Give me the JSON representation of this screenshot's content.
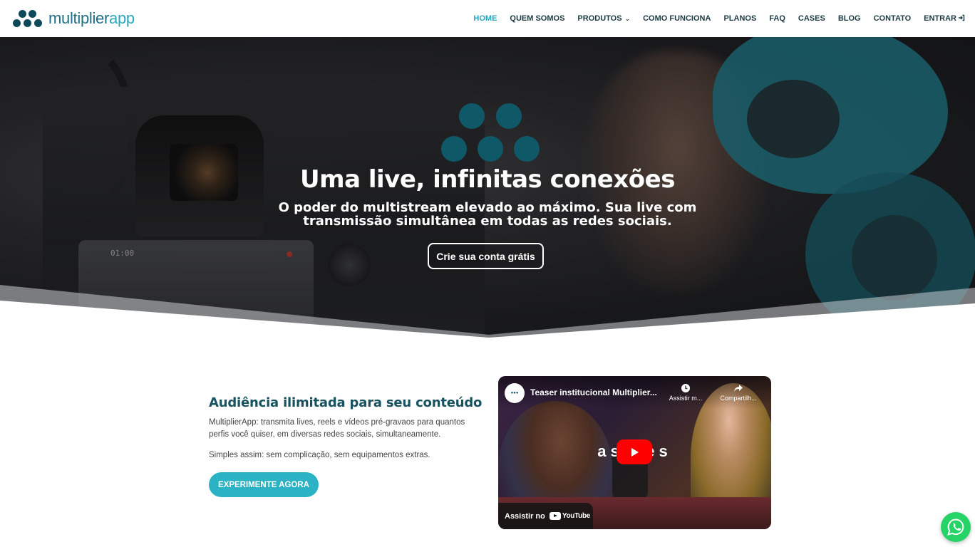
{
  "brand": {
    "name_part1": "multiplier",
    "name_part2": "app"
  },
  "nav": {
    "home": "HOME",
    "about": "QUEM SOMOS",
    "products": "PRODUTOS",
    "how": "COMO FUNCIONA",
    "plans": "PLANOS",
    "faq": "FAQ",
    "cases": "CASES",
    "blog": "BLOG",
    "contact": "CONTATO",
    "login": "ENTRAR"
  },
  "hero": {
    "title": "Uma live, infinitas conexões",
    "subtitle": "O poder do multistream elevado ao máximo. Sua live com transmissão simultânea em todas as redes sociais.",
    "cta": "Crie sua conta grátis",
    "camera_readout": "01:00"
  },
  "section": {
    "title": "Audiência ilimitada para seu conteúdo",
    "paragraph1": "MultiplierApp: transmita lives, reels e vídeos pré-gravaos para quantos perfis você quiser, em diversas redes sociais, simultaneamente.",
    "paragraph2": "Simples assim: sem complicação, sem equipamentos extras.",
    "cta": "EXPERIMENTE AGORA"
  },
  "video": {
    "title": "Teaser institucional Multiplier...",
    "watch_later": "Assistir m...",
    "share": "Compartilh...",
    "overlay_text": "as   des",
    "watch_on": "Assistir no",
    "youtube": "YouTube"
  },
  "colors": {
    "accent": "#2aa6bd",
    "brand_dark": "#0f5868",
    "cta_bg": "#2bb2c4",
    "title": "#16525f",
    "whatsapp": "#25d366",
    "youtube_red": "#ff0000"
  },
  "icons": {
    "logo": "dots-logo-icon",
    "products_dropdown": "chevron-down-icon",
    "login": "login-arrow-icon",
    "watch_later": "clock-icon",
    "share": "share-arrow-icon",
    "play": "play-icon",
    "whatsapp": "whatsapp-icon"
  }
}
